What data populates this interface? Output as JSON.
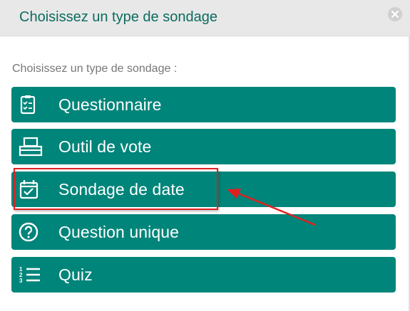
{
  "dialog": {
    "title": "Choisissez un type de sondage",
    "subtitle": "Choisissez un type de sondage :",
    "close_icon": "close-circle-icon"
  },
  "options": [
    {
      "label": "Questionnaire",
      "icon": "clipboard-checklist-icon"
    },
    {
      "label": "Outil de vote",
      "icon": "ballot-box-icon"
    },
    {
      "label": "Sondage de date",
      "icon": "calendar-check-icon"
    },
    {
      "label": "Question unique",
      "icon": "question-circle-icon"
    },
    {
      "label": "Quiz",
      "icon": "numbered-list-icon"
    }
  ],
  "colors": {
    "accent": "#00857a",
    "title": "#0d6b5f",
    "annotation": "#e02020"
  }
}
